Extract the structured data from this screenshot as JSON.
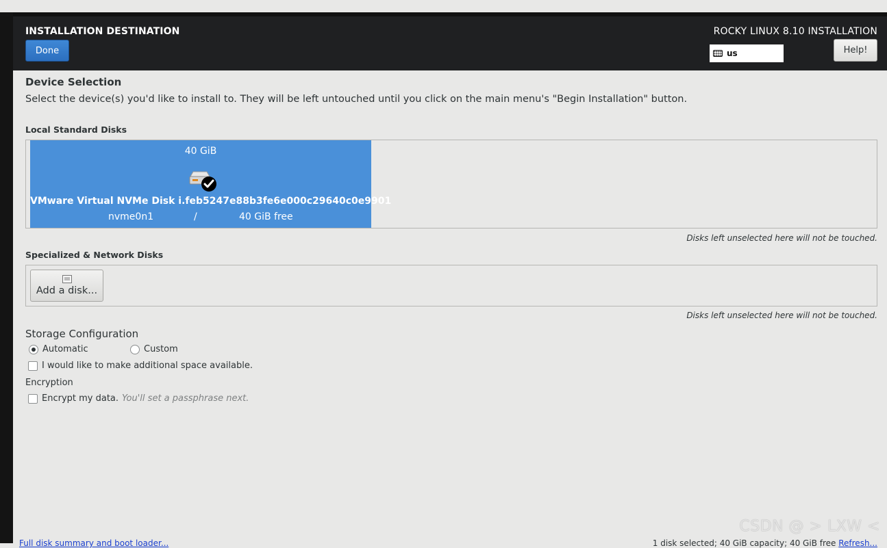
{
  "header": {
    "title": "INSTALLATION DESTINATION",
    "done_label": "Done",
    "product_title": "ROCKY LINUX 8.10 INSTALLATION",
    "keyboard_layout": "us",
    "help_label": "Help!"
  },
  "device_selection": {
    "heading": "Device Selection",
    "description": "Select the device(s) you'd like to install to.  They will be left untouched until you click on the main menu's \"Begin Installation\" button.",
    "local_disks_heading": "Local Standard Disks",
    "disks": [
      {
        "size": "40 GiB",
        "name": "VMware Virtual NVMe Disk i.feb5247e88b3fe6e000c29640c0e9901",
        "device": "nvme0n1",
        "separator": "/",
        "free": "40 GiB free",
        "selected": true
      }
    ],
    "local_note": "Disks left unselected here will not be touched.",
    "network_heading": "Specialized & Network Disks",
    "add_disk_label": "Add a disk...",
    "network_note": "Disks left unselected here will not be touched."
  },
  "storage_config": {
    "heading": "Storage Configuration",
    "automatic_label": "Automatic",
    "custom_label": "Custom",
    "selected": "automatic",
    "additional_space_label": "I would like to make additional space available."
  },
  "encryption": {
    "heading": "Encryption",
    "encrypt_label": "Encrypt my data.",
    "encrypt_hint": "You'll set a passphrase next."
  },
  "footer": {
    "summary_link": "Full disk summary and boot loader...",
    "status_text": "1 disk selected; 40 GiB capacity; 40 GiB free",
    "refresh_link": "Refresh..."
  },
  "watermark": "CSDN @ > LXW <",
  "colors": {
    "accent": "#4a90d9",
    "header_bg": "#1f2022",
    "page_bg": "#e8e8e7"
  }
}
